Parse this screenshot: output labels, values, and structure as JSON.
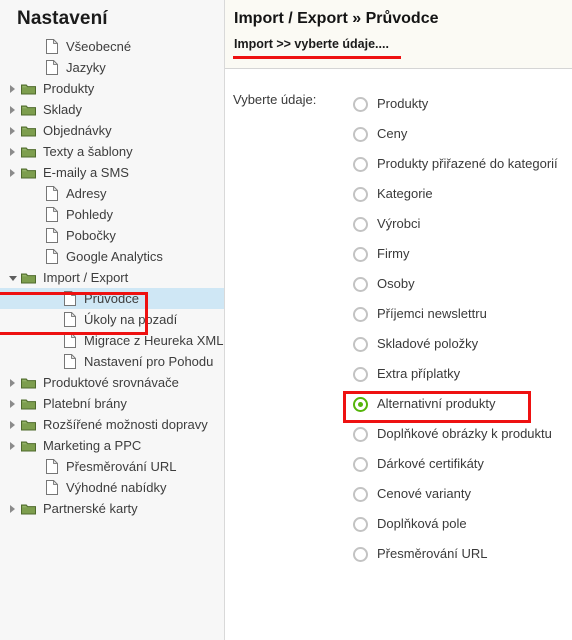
{
  "colors": {
    "accent_green": "#55b50a",
    "annotation_red": "#ee1111",
    "selection_blue": "#cfe7f5",
    "folder_green": "#7d9e4e",
    "sidebar_bg": "#f7f7f7",
    "header_bg": "#fbfaf4"
  },
  "sidebar": {
    "title": "Nastavení",
    "items": [
      {
        "label": "Všeobecné",
        "icon": "file-icon",
        "level": 1,
        "twisty": "none",
        "selected": false
      },
      {
        "label": "Jazyky",
        "icon": "file-icon",
        "level": 1,
        "twisty": "none",
        "selected": false
      },
      {
        "label": "Produkty",
        "icon": "folder-icon",
        "level": 0,
        "twisty": "closed",
        "selected": false
      },
      {
        "label": "Sklady",
        "icon": "folder-icon",
        "level": 0,
        "twisty": "closed",
        "selected": false
      },
      {
        "label": "Objednávky",
        "icon": "folder-icon",
        "level": 0,
        "twisty": "closed",
        "selected": false
      },
      {
        "label": "Texty a šablony",
        "icon": "folder-icon",
        "level": 0,
        "twisty": "closed",
        "selected": false
      },
      {
        "label": "E-maily a SMS",
        "icon": "folder-icon",
        "level": 0,
        "twisty": "closed",
        "selected": false
      },
      {
        "label": "Adresy",
        "icon": "file-icon",
        "level": 1,
        "twisty": "none",
        "selected": false
      },
      {
        "label": "Pohledy",
        "icon": "file-icon",
        "level": 1,
        "twisty": "none",
        "selected": false
      },
      {
        "label": "Pobočky",
        "icon": "file-icon",
        "level": 1,
        "twisty": "none",
        "selected": false
      },
      {
        "label": "Google Analytics",
        "icon": "file-icon",
        "level": 1,
        "twisty": "none",
        "selected": false
      },
      {
        "label": "Import / Export",
        "icon": "folder-icon",
        "level": 0,
        "twisty": "open",
        "selected": false
      },
      {
        "label": "Průvodce",
        "icon": "file-icon",
        "level": 2,
        "twisty": "none",
        "selected": true
      },
      {
        "label": "Úkoly na pozadí",
        "icon": "file-icon",
        "level": 2,
        "twisty": "none",
        "selected": false
      },
      {
        "label": "Migrace z Heureka XML",
        "icon": "file-icon",
        "level": 2,
        "twisty": "none",
        "selected": false
      },
      {
        "label": "Nastavení pro Pohodu",
        "icon": "file-icon",
        "level": 2,
        "twisty": "none",
        "selected": false
      },
      {
        "label": "Produktové srovnávače",
        "icon": "folder-icon",
        "level": 0,
        "twisty": "closed",
        "selected": false
      },
      {
        "label": "Platební brány",
        "icon": "folder-icon",
        "level": 0,
        "twisty": "closed",
        "selected": false
      },
      {
        "label": "Rozšířené možnosti dopravy",
        "icon": "folder-icon",
        "level": 0,
        "twisty": "closed",
        "selected": false
      },
      {
        "label": "Marketing a PPC",
        "icon": "folder-icon",
        "level": 0,
        "twisty": "closed",
        "selected": false
      },
      {
        "label": "Přesměrování URL",
        "icon": "file-icon",
        "level": 1,
        "twisty": "none",
        "selected": false
      },
      {
        "label": "Výhodné nabídky",
        "icon": "file-icon",
        "level": 1,
        "twisty": "none",
        "selected": false
      },
      {
        "label": "Partnerské karty",
        "icon": "folder-icon",
        "level": 0,
        "twisty": "closed",
        "selected": false
      }
    ]
  },
  "main": {
    "title": "Import / Export » Průvodce",
    "breadcrumb": "Import >> vyberte údaje....",
    "field_label": "Vyberte údaje:",
    "options": [
      {
        "label": "Produkty",
        "checked": false,
        "highlighted": false
      },
      {
        "label": "Ceny",
        "checked": false,
        "highlighted": false
      },
      {
        "label": "Produkty přiřazené do kategorií",
        "checked": false,
        "highlighted": false
      },
      {
        "label": "Kategorie",
        "checked": false,
        "highlighted": false
      },
      {
        "label": "Výrobci",
        "checked": false,
        "highlighted": false
      },
      {
        "label": "Firmy",
        "checked": false,
        "highlighted": false
      },
      {
        "label": "Osoby",
        "checked": false,
        "highlighted": false
      },
      {
        "label": "Příjemci newslettru",
        "checked": false,
        "highlighted": false
      },
      {
        "label": "Skladové položky",
        "checked": false,
        "highlighted": false
      },
      {
        "label": "Extra příplatky",
        "checked": false,
        "highlighted": false
      },
      {
        "label": "Alternativní produkty",
        "checked": true,
        "highlighted": true
      },
      {
        "label": "Doplňkové obrázky k produktu",
        "checked": false,
        "highlighted": false
      },
      {
        "label": "Dárkové certifikáty",
        "checked": false,
        "highlighted": false
      },
      {
        "label": "Cenové varianty",
        "checked": false,
        "highlighted": false
      },
      {
        "label": "Doplňková pole",
        "checked": false,
        "highlighted": false
      },
      {
        "label": "Přesměrování URL",
        "checked": false,
        "highlighted": false
      }
    ]
  }
}
